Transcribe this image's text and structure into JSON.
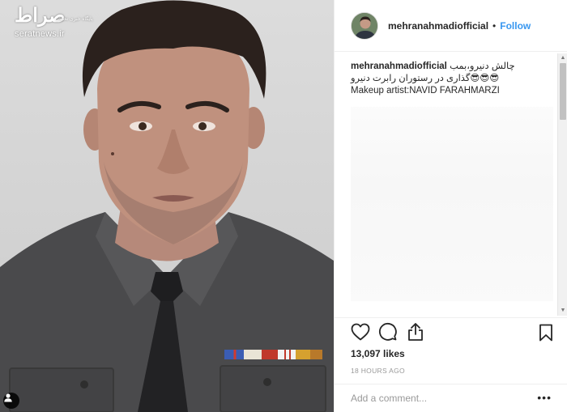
{
  "photo": {
    "watermark_logo": "صراط",
    "watermark_tagline": "پایگاه خبری تحلیلی",
    "watermark_site": "seratnews.ir"
  },
  "post": {
    "username": "mehranahmadiofficial",
    "follow_label": "Follow",
    "header_separator": "•",
    "caption": {
      "author": "mehranahmadiofficial",
      "line1": "چالش دنیرو،بمب",
      "line2": "😎😎😎گذاری در رستوران رابرت دنیرو",
      "line3": "Makeup artist:NAVID FARAHMARZI"
    },
    "likes": "13,097 likes",
    "timestamp": "18 HOURS AGO",
    "comment_placeholder": "Add a comment...",
    "more_label": "•••"
  },
  "icons": {
    "like": "heart-icon",
    "comment": "comment-icon",
    "share": "share-icon",
    "save": "bookmark-icon",
    "tagged_users": "user-icon",
    "scroll_up": "arrow-up-icon",
    "scroll_down": "arrow-down-icon"
  },
  "colors": {
    "follow_blue": "#3897f0",
    "text": "#262626",
    "muted": "#999999",
    "border": "#efefef"
  }
}
